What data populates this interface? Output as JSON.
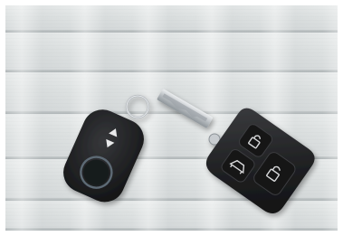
{
  "scene": {
    "description_items": [
      "keyless-fob",
      "flip-key"
    ],
    "colors": {
      "background": "#ffffff",
      "wood": "#dde1e1",
      "fob_body": "#1d1e20",
      "metal": "#c9cdd0"
    }
  }
}
